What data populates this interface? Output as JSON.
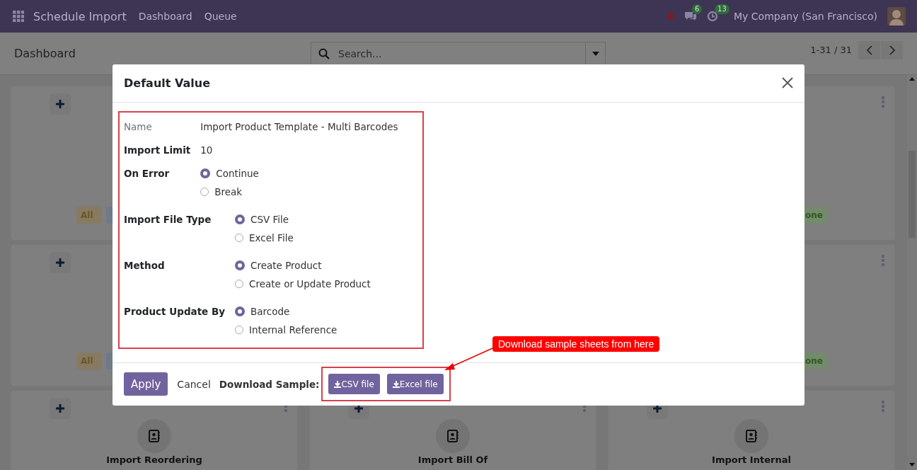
{
  "navbar": {
    "app_title": "Schedule Import",
    "menu": [
      "Dashboard",
      "Queue"
    ],
    "messages_count": "6",
    "activities_count": "13",
    "company": "My Company (San Francisco)"
  },
  "control_panel": {
    "title": "Dashboard",
    "search": {
      "placeholder": "Search..."
    },
    "pager": "1-31 / 31"
  },
  "card_rows": [
    {
      "left": {
        "badges": [
          {
            "text": "All",
            "color": "#867a63"
          },
          {
            "color": "#6f7a88"
          }
        ]
      },
      "right": {
        "badges": [
          {
            "text": "one",
            "color": "#738a6c"
          }
        ]
      }
    },
    {
      "left": {
        "badges": [
          {
            "text": "All",
            "color": "#867a63"
          },
          {
            "color": "#6f7a88"
          }
        ]
      },
      "right": {
        "badges": [
          {
            "text": "one",
            "color": "#738a6c"
          }
        ]
      }
    },
    {
      "left": {
        "title": "Import Reordering"
      },
      "middle": {
        "title": "Import Bill Of"
      },
      "right": {
        "title": "Import Internal"
      }
    }
  ],
  "dialog": {
    "title": "Default Value",
    "groups": [
      [
        {
          "kind": "text",
          "label": "Name",
          "muted": true,
          "value": "Import Product Template - Multi Barcodes"
        },
        {
          "kind": "text",
          "label": "Import Limit",
          "muted": false,
          "value": "10"
        },
        {
          "kind": "radio",
          "label": "On Error",
          "options": [
            {
              "label": "Continue",
              "selected": true
            },
            {
              "label": "Break",
              "selected": false
            }
          ]
        }
      ],
      [
        {
          "kind": "radio",
          "label": "Import File Type",
          "options": [
            {
              "label": "CSV File",
              "selected": true
            },
            {
              "label": "Excel File",
              "selected": false
            }
          ]
        },
        {
          "kind": "radio",
          "label": "Method",
          "options": [
            {
              "label": "Create Product",
              "selected": true
            },
            {
              "label": "Create or Update Product",
              "selected": false
            }
          ]
        },
        {
          "kind": "radio",
          "label": "Product Update By",
          "options": [
            {
              "label": "Barcode",
              "selected": true
            },
            {
              "label": "Internal Reference",
              "selected": false
            }
          ]
        }
      ]
    ],
    "footer": {
      "apply": "Apply",
      "cancel": "Cancel",
      "download_label": "Download Sample:",
      "downloads": [
        "CSV file",
        "Excel file"
      ]
    },
    "callout": "Download sample sheets from here"
  }
}
